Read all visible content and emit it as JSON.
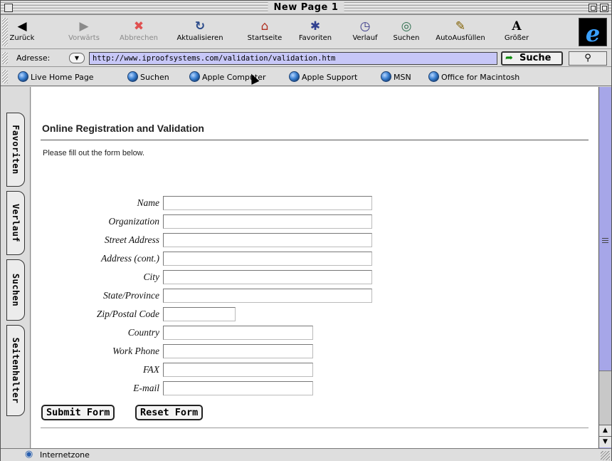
{
  "window": {
    "title": "New Page 1"
  },
  "toolbar": {
    "buttons": [
      {
        "label": "Zurück",
        "icon": "back-arrow-icon",
        "glyph": "◀"
      },
      {
        "label": "Vorwärts",
        "icon": "forward-arrow-icon",
        "glyph": "▶"
      },
      {
        "label": "Abbrechen",
        "icon": "stop-icon",
        "glyph": "✖"
      },
      {
        "label": "Aktualisieren",
        "icon": "refresh-icon",
        "glyph": "↻"
      },
      {
        "label": "Startseite",
        "icon": "home-icon",
        "glyph": "⌂"
      },
      {
        "label": "Favoriten",
        "icon": "favorites-icon",
        "glyph": "✱"
      },
      {
        "label": "Verlauf",
        "icon": "history-icon",
        "glyph": "◷"
      },
      {
        "label": "Suchen",
        "icon": "search-icon",
        "glyph": "◎"
      },
      {
        "label": "AutoAusfüllen",
        "icon": "autofill-icon",
        "glyph": "✎"
      },
      {
        "label": "Größer",
        "icon": "larger-text-icon",
        "glyph": "A"
      }
    ]
  },
  "address": {
    "label": "Adresse:",
    "url": "http://www.iproofsystems.com/validation/validation.htm",
    "go_label": "Suche",
    "go_glyph": "➦",
    "mag_glyph": "⚲"
  },
  "favorites": [
    "Live Home Page",
    "Suchen",
    "Apple Computer",
    "Apple Support",
    "MSN",
    "Office for Macintosh"
  ],
  "side_tabs": [
    "Favoriten",
    "Verlauf",
    "Suchen",
    "Seitenhalter"
  ],
  "page": {
    "title": "Online Registration and Validation",
    "intro": "Please fill out the form below.",
    "fields": [
      {
        "label": "Name",
        "value": ""
      },
      {
        "label": "Organization",
        "value": ""
      },
      {
        "label": "Street Address",
        "value": ""
      },
      {
        "label": "Address (cont.)",
        "value": ""
      },
      {
        "label": "City",
        "value": ""
      },
      {
        "label": "State/Province",
        "value": ""
      },
      {
        "label": "Zip/Postal Code",
        "value": ""
      },
      {
        "label": "Country",
        "value": ""
      },
      {
        "label": "Work Phone",
        "value": ""
      },
      {
        "label": "FAX",
        "value": ""
      },
      {
        "label": "E-mail",
        "value": ""
      }
    ],
    "submit_label": "Submit Form",
    "reset_label": "Reset Form"
  },
  "status": {
    "zone": "Internetzone",
    "zone_glyph": "◉"
  },
  "colors": {
    "address_bg": "#c7c7f7",
    "scrollbar": "#a6a6e8",
    "ie_blue": "#3aa0ff"
  }
}
